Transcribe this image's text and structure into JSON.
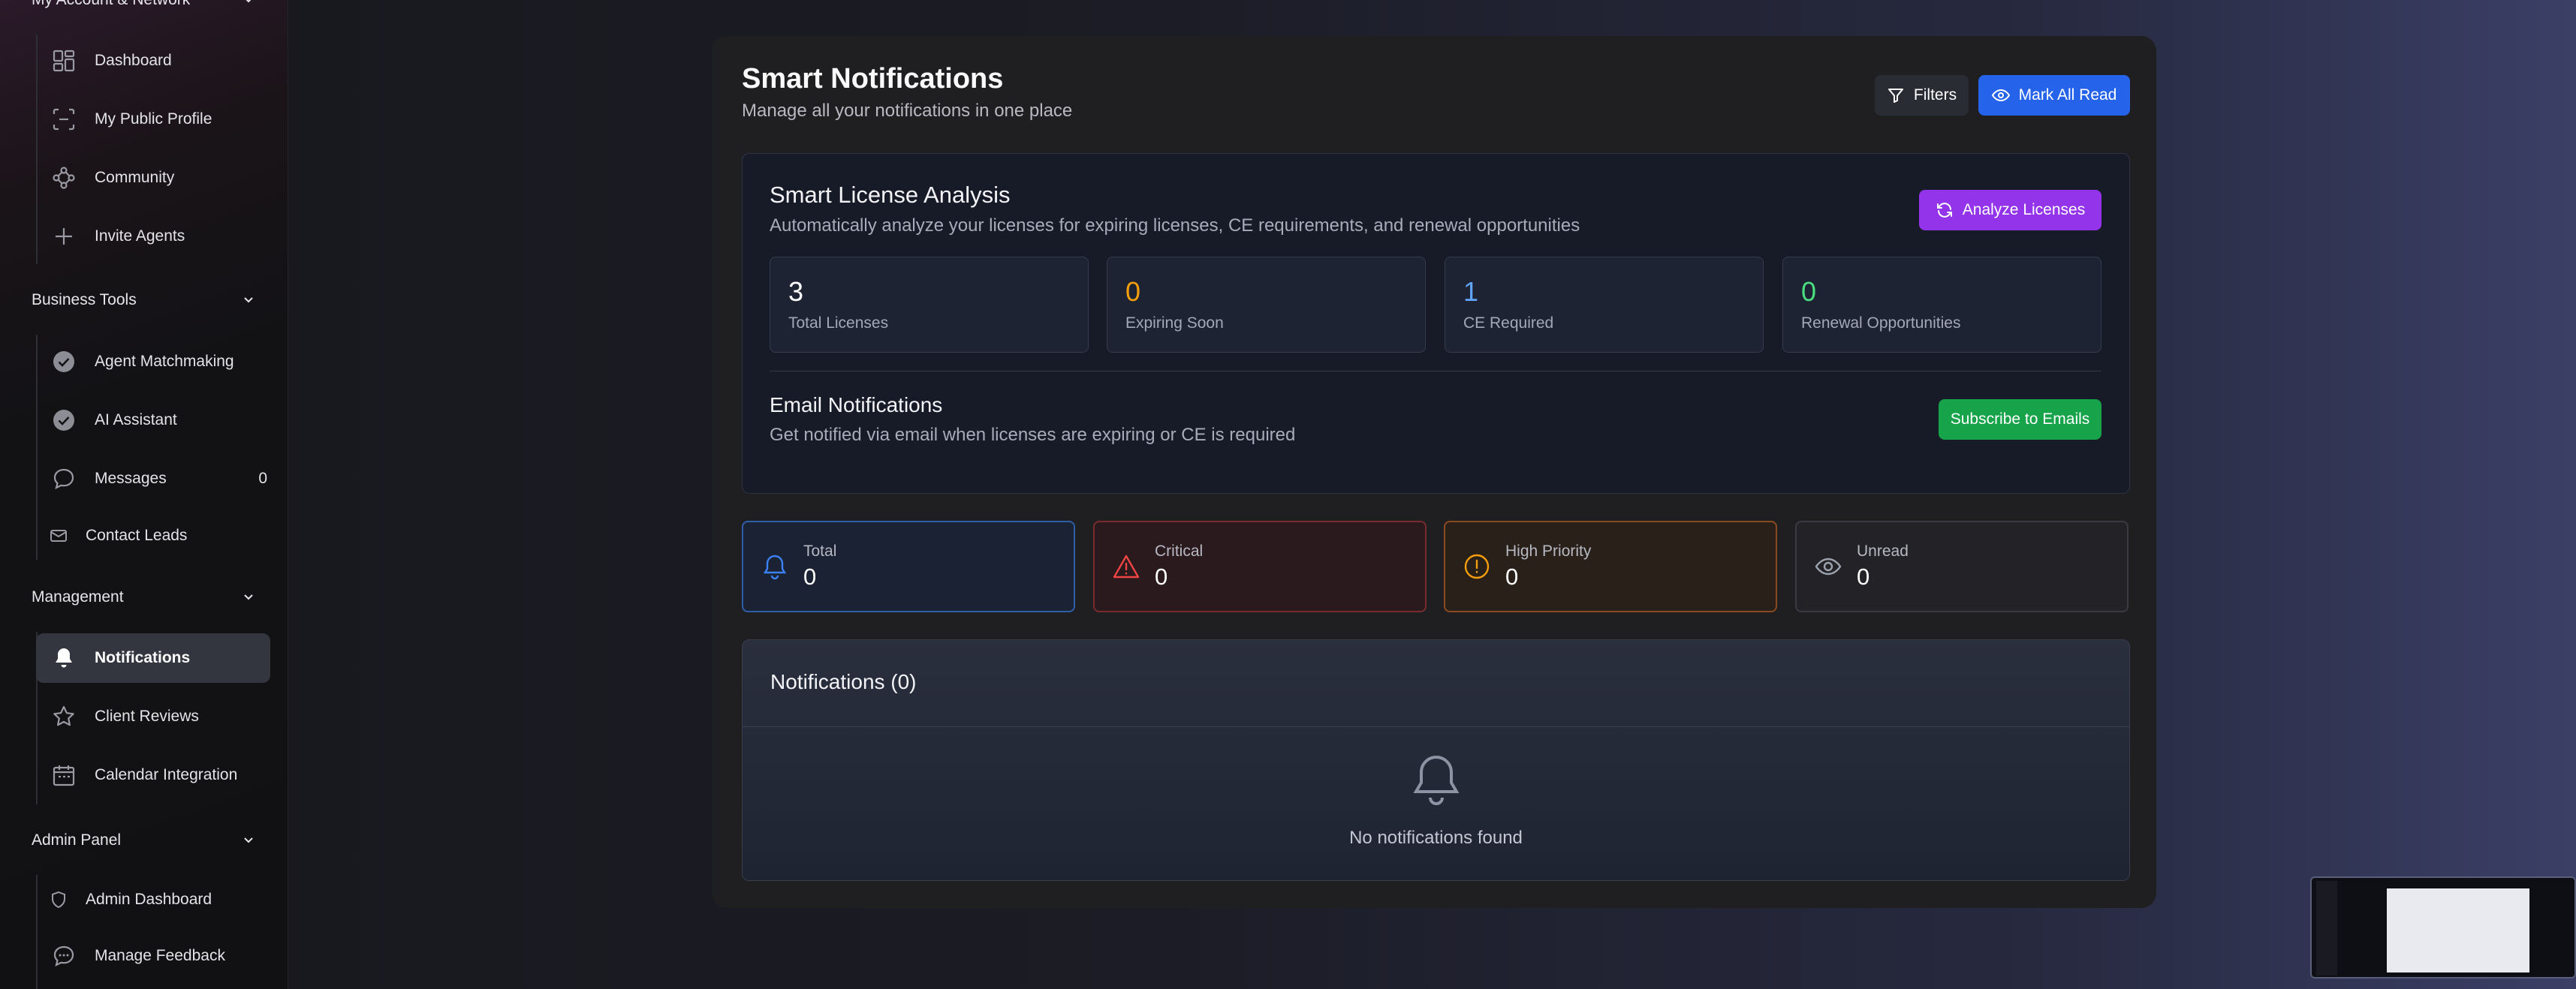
{
  "sidebar": {
    "sections": [
      {
        "title": "My Account & Network",
        "items": [
          {
            "label": "Dashboard",
            "icon": "dashboard-grid-icon"
          },
          {
            "label": "My Public Profile",
            "icon": "profile-scan-icon"
          },
          {
            "label": "Community",
            "icon": "network-icon"
          },
          {
            "label": "Invite Agents",
            "icon": "plus-icon"
          }
        ]
      },
      {
        "title": "Business Tools",
        "items": [
          {
            "label": "Agent Matchmaking",
            "icon": "check-circle-icon"
          },
          {
            "label": "AI Assistant",
            "icon": "check-circle-icon"
          },
          {
            "label": "Messages",
            "icon": "chat-bubble-icon",
            "count": "0"
          },
          {
            "label": "Contact Leads",
            "icon": "mail-icon"
          }
        ]
      },
      {
        "title": "Management",
        "items": [
          {
            "label": "Notifications",
            "icon": "bell-icon",
            "active": true
          },
          {
            "label": "Client Reviews",
            "icon": "star-icon"
          },
          {
            "label": "Calendar Integration",
            "icon": "calendar-icon"
          }
        ]
      },
      {
        "title": "Admin Panel",
        "items": [
          {
            "label": "Admin Dashboard",
            "icon": "shield-icon"
          },
          {
            "label": "Manage Feedback",
            "icon": "chat-bubble-icon"
          }
        ]
      }
    ]
  },
  "header": {
    "title": "Smart Notifications",
    "subtitle": "Manage all your notifications in one place",
    "filters_label": "Filters",
    "mark_all_read_label": "Mark All Read"
  },
  "license_analysis": {
    "title": "Smart License Analysis",
    "subtitle": "Automatically analyze your licenses for expiring licenses, CE requirements, and renewal opportunities",
    "analyze_label": "Analyze Licenses",
    "stats": [
      {
        "value": "3",
        "label": "Total Licenses",
        "color": "#ffffff"
      },
      {
        "value": "0",
        "label": "Expiring Soon",
        "color": "#f59e0b"
      },
      {
        "value": "1",
        "label": "CE Required",
        "color": "#60a5fa"
      },
      {
        "value": "0",
        "label": "Renewal Opportunities",
        "color": "#4ade80"
      }
    ]
  },
  "email_notifications": {
    "title": "Email Notifications",
    "subtitle": "Get notified via email when licenses are expiring or CE is required",
    "subscribe_label": "Subscribe to Emails"
  },
  "counts": [
    {
      "label": "Total",
      "value": "0",
      "icon": "bell-icon",
      "color": "#3b82f6"
    },
    {
      "label": "Critical",
      "value": "0",
      "icon": "alert-triangle-icon",
      "color": "#ef4444"
    },
    {
      "label": "High Priority",
      "value": "0",
      "icon": "alert-circle-icon",
      "color": "#f59e0b"
    },
    {
      "label": "Unread",
      "value": "0",
      "icon": "eye-icon",
      "color": "#9ca3af"
    }
  ],
  "notifications": {
    "title": "Notifications (0)",
    "empty_text": "No notifications found"
  },
  "colors": {
    "accent_blue": "#2563eb",
    "accent_purple": "#9333ea",
    "accent_green": "#16a34a"
  }
}
